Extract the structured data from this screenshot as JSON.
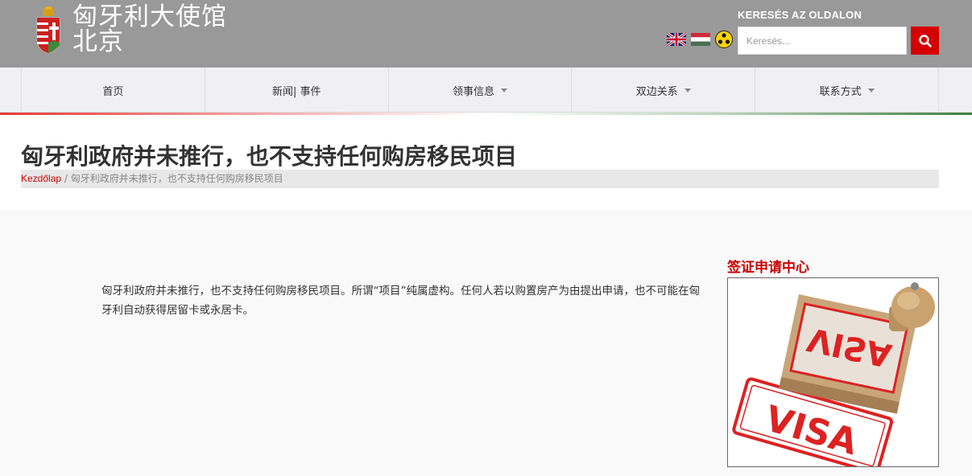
{
  "header": {
    "title_line1": "匈牙利大使馆",
    "title_line2": "北京",
    "search_heading": "KERESÉS AZ OLDALON",
    "search_placeholder": "Keresés...",
    "language_flags": [
      "uk-flag-icon",
      "hungary-flag-icon"
    ],
    "accessibility_icon": "low-vision-icon",
    "search_icon": "search-icon"
  },
  "nav": {
    "items": [
      {
        "label": "首页",
        "dropdown": false
      },
      {
        "label": "新闻| 事件",
        "dropdown": false
      },
      {
        "label": "领事信息",
        "dropdown": true
      },
      {
        "label": "双边关系",
        "dropdown": true
      },
      {
        "label": "联系方式",
        "dropdown": true
      }
    ]
  },
  "page": {
    "title": "匈牙利政府并未推行，也不支持任何购房移民项目",
    "breadcrumb_home": "Kezdőlap",
    "breadcrumb_separator": " / ",
    "breadcrumb_current": "匈牙利政府并未推行，也不支持任何购房移民项目",
    "body": "匈牙利政府并未推行，也不支持任何购房移民项目。所谓“项目”纯属虚构。任何人若以购置房产为由提出申请，也不可能在匈牙利自动获得居留卡或永居卡。"
  },
  "sidebar": {
    "heading": "签证申请中心",
    "image_text_stamp": "VISA",
    "image_text_print": "VISA"
  },
  "colors": {
    "header_bg": "#999999",
    "accent_red": "#d50000",
    "nav_bg": "#f0f0f3"
  }
}
